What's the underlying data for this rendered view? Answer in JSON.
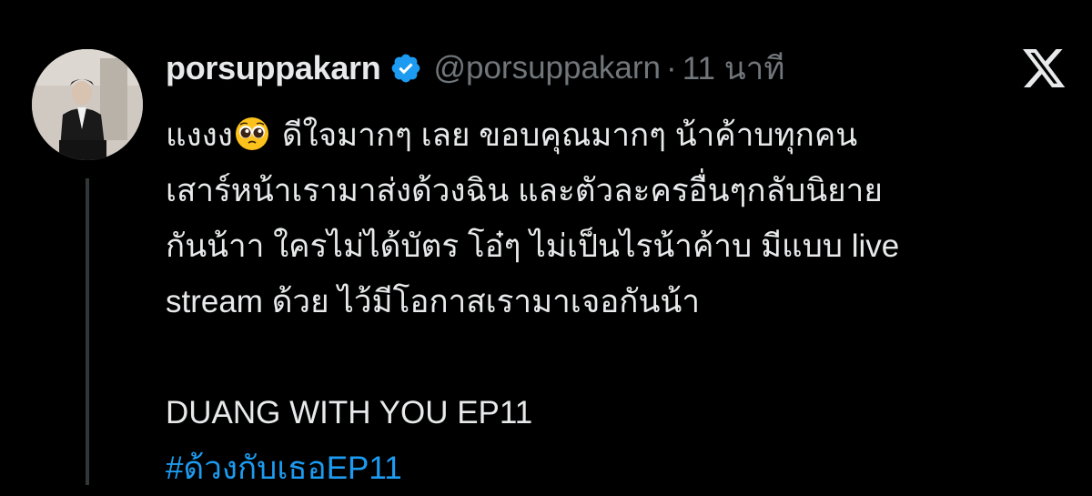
{
  "tweet": {
    "display_name": "porsuppakarn",
    "handle": "@porsuppakarn",
    "separator": "·",
    "time": "11 นาที",
    "body_lines": {
      "l1_before": "แงงง",
      "l1_after": "ดีใจมากๆ เลย ขอบคุณมากๆ น้าค้าบทุกคน",
      "l2": "เสาร์หน้าเรามาส่งด้วงฉิน และตัวละครอื่นๆกลับนิยาย",
      "l3": "กันน้าา ใครไม่ได้บัตร โอ๋ๆ ไม่เป็นไรน้าค้าบ มีแบบ live",
      "l4": "stream ด้วย ไว้มีโอกาสเรามาเจอกันน้า",
      "l5": "DUANG WITH YOU EP11"
    },
    "hashtag": "#ด้วงกับเธอEP11",
    "emoji": "pleading-face-emoji"
  },
  "icons": {
    "verified": "verified-badge-icon",
    "logo": "x-logo-icon"
  },
  "colors": {
    "background": "#000000",
    "text_primary": "#e7e9ea",
    "text_secondary": "#71767b",
    "link": "#1d9bf0",
    "verified": "#1d9bf0",
    "thread_line": "#333639"
  }
}
